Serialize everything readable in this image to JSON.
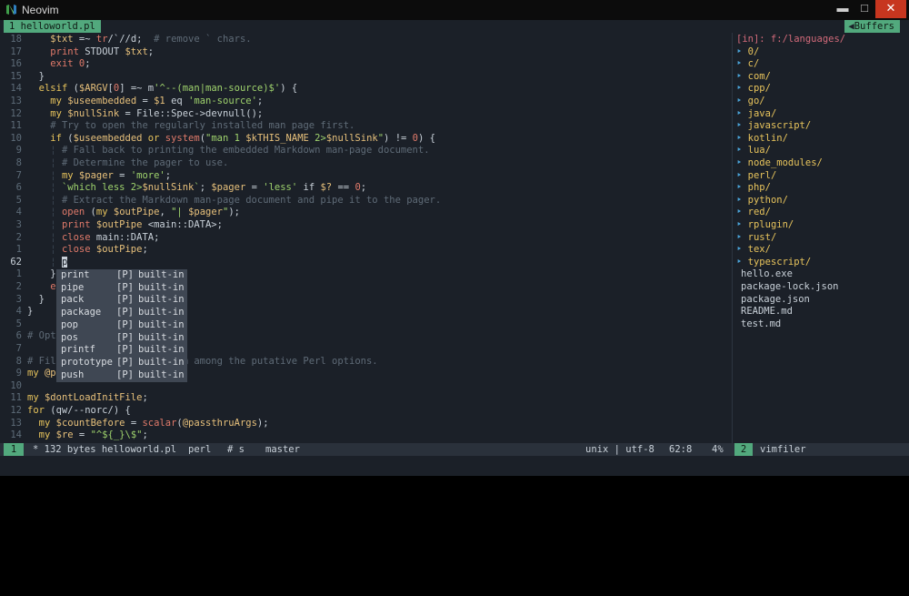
{
  "window": {
    "title": "Neovim",
    "min_glyph": "▬",
    "max_glyph": "□",
    "close_glyph": "✕"
  },
  "tabline": {
    "active_tab": "1 helloworld.pl",
    "buffers_label": "Buffers"
  },
  "editor": {
    "lines": [
      {
        "n": "18",
        "segs": [
          [
            "ig",
            "    "
          ],
          [
            "var",
            "$txt"
          ],
          [
            "op",
            " =~ "
          ],
          [
            "fn",
            "tr"
          ],
          [
            "op",
            "/`//d;"
          ],
          [
            "com",
            "  # remove ` chars."
          ]
        ]
      },
      {
        "n": "17",
        "segs": [
          [
            "ig",
            "    "
          ],
          [
            "fn",
            "print"
          ],
          [
            "plain",
            " STDOUT "
          ],
          [
            "var",
            "$txt"
          ],
          [
            "op",
            ";"
          ]
        ]
      },
      {
        "n": "16",
        "segs": [
          [
            "ig",
            "    "
          ],
          [
            "fn",
            "exit"
          ],
          [
            "op",
            " "
          ],
          [
            "num",
            "0"
          ],
          [
            "op",
            ";"
          ]
        ]
      },
      {
        "n": "15",
        "segs": [
          [
            "ig",
            "  "
          ],
          [
            "op",
            "}"
          ]
        ]
      },
      {
        "n": "14",
        "segs": [
          [
            "ig",
            "  "
          ],
          [
            "kw",
            "elsif"
          ],
          [
            "op",
            " ("
          ],
          [
            "var",
            "$ARGV"
          ],
          [
            "op",
            "["
          ],
          [
            "num",
            "0"
          ],
          [
            "op",
            "] =~ m"
          ],
          [
            "str",
            "'^--(man|man-source)$'"
          ],
          [
            "op",
            ") {"
          ]
        ]
      },
      {
        "n": "13",
        "segs": [
          [
            "ig",
            "    "
          ],
          [
            "kw",
            "my"
          ],
          [
            "op",
            " "
          ],
          [
            "var",
            "$useembedded"
          ],
          [
            "op",
            " = "
          ],
          [
            "var",
            "$1"
          ],
          [
            "op",
            " eq "
          ],
          [
            "str",
            "'man-source'"
          ],
          [
            "op",
            ";"
          ]
        ]
      },
      {
        "n": "12",
        "segs": [
          [
            "ig",
            "    "
          ],
          [
            "kw",
            "my"
          ],
          [
            "op",
            " "
          ],
          [
            "var",
            "$nullSink"
          ],
          [
            "op",
            " = File::Spec->devnull();"
          ]
        ]
      },
      {
        "n": "11",
        "segs": [
          [
            "ig",
            "    "
          ],
          [
            "com",
            "# Try to open the regularly installed man page first."
          ]
        ]
      },
      {
        "n": "10",
        "segs": [
          [
            "ig",
            "    "
          ],
          [
            "kw",
            "if"
          ],
          [
            "op",
            " ("
          ],
          [
            "var",
            "$useembedded"
          ],
          [
            "kw",
            " or "
          ],
          [
            "fn",
            "system"
          ],
          [
            "op",
            "("
          ],
          [
            "str",
            "\"man 1 "
          ],
          [
            "var",
            "$kTHIS_NAME"
          ],
          [
            "str",
            " 2>"
          ],
          [
            "var",
            "$nullSink"
          ],
          [
            "str",
            "\""
          ],
          [
            "op",
            ") != "
          ],
          [
            "num",
            "0"
          ],
          [
            "op",
            ") {"
          ]
        ]
      },
      {
        "n": "9",
        "segs": [
          [
            "ig",
            "    ¦ "
          ],
          [
            "com",
            "# Fall back to printing the embedded Markdown man-page document."
          ]
        ]
      },
      {
        "n": "8",
        "segs": [
          [
            "ig",
            "    ¦ "
          ],
          [
            "com",
            "# Determine the pager to use."
          ]
        ]
      },
      {
        "n": "7",
        "segs": [
          [
            "ig",
            "    ¦ "
          ],
          [
            "kw",
            "my"
          ],
          [
            "op",
            " "
          ],
          [
            "var",
            "$pager"
          ],
          [
            "op",
            " = "
          ],
          [
            "str",
            "'more'"
          ],
          [
            "op",
            ";"
          ]
        ]
      },
      {
        "n": "6",
        "segs": [
          [
            "ig",
            "    ¦ "
          ],
          [
            "str",
            "`which less 2>"
          ],
          [
            "var",
            "$nullSink"
          ],
          [
            "str",
            "`"
          ],
          [
            "op",
            "; "
          ],
          [
            "var",
            "$pager"
          ],
          [
            "op",
            " = "
          ],
          [
            "str",
            "'less'"
          ],
          [
            "op",
            " if "
          ],
          [
            "var",
            "$?"
          ],
          [
            "op",
            " == "
          ],
          [
            "num",
            "0"
          ],
          [
            "op",
            ";"
          ]
        ]
      },
      {
        "n": "5",
        "segs": [
          [
            "ig",
            "    ¦ "
          ],
          [
            "com",
            "# Extract the Markdown man-page document and pipe it to the pager."
          ]
        ]
      },
      {
        "n": "4",
        "segs": [
          [
            "ig",
            "    ¦ "
          ],
          [
            "fn",
            "open"
          ],
          [
            "op",
            " ("
          ],
          [
            "kw",
            "my"
          ],
          [
            "op",
            " "
          ],
          [
            "var",
            "$outPipe"
          ],
          [
            "op",
            ", "
          ],
          [
            "str",
            "\"| "
          ],
          [
            "var",
            "$pager"
          ],
          [
            "str",
            "\""
          ],
          [
            "op",
            ");"
          ]
        ]
      },
      {
        "n": "3",
        "segs": [
          [
            "ig",
            "    ¦ "
          ],
          [
            "fn",
            "print"
          ],
          [
            "op",
            " "
          ],
          [
            "var",
            "$outPipe"
          ],
          [
            "op",
            " <main::DATA>;"
          ]
        ]
      },
      {
        "n": "2",
        "segs": [
          [
            "ig",
            "    ¦ "
          ],
          [
            "fn",
            "close"
          ],
          [
            "op",
            " main::DATA;"
          ]
        ]
      },
      {
        "n": "1",
        "segs": [
          [
            "ig",
            "    ¦ "
          ],
          [
            "fn",
            "close"
          ],
          [
            "op",
            " "
          ],
          [
            "var",
            "$outPipe"
          ],
          [
            "op",
            ";"
          ]
        ]
      },
      {
        "n": "62",
        "cur": true,
        "segs": [
          [
            "ig",
            "    ¦ "
          ],
          [
            "cursor",
            "p"
          ]
        ]
      },
      {
        "n": "1",
        "segs": [
          [
            "ig",
            "    "
          ],
          [
            "op",
            "}"
          ]
        ]
      },
      {
        "n": "2",
        "segs": [
          [
            "ig",
            "    "
          ],
          [
            "fn",
            "e"
          ]
        ]
      },
      {
        "n": "3",
        "segs": [
          [
            "ig",
            "  "
          ],
          [
            "op",
            "}"
          ]
        ]
      },
      {
        "n": "4",
        "segs": [
          [
            "op",
            "}"
          ]
        ]
      },
      {
        "n": "5",
        "segs": [
          [
            "plain",
            ""
          ]
        ]
      },
      {
        "n": "6",
        "segs": [
          [
            "com",
            "# Opt"
          ]
        ]
      },
      {
        "n": "7",
        "segs": [
          [
            "plain",
            ""
          ]
        ]
      },
      {
        "n": "8",
        "segs": [
          [
            "com",
            "# Fil                   from among the putative Perl options."
          ]
        ]
      },
      {
        "n": "9",
        "segs": [
          [
            "kw",
            "my"
          ],
          [
            "op",
            " "
          ],
          [
            "var",
            "@p"
          ]
        ]
      },
      {
        "n": "10",
        "segs": [
          [
            "plain",
            ""
          ]
        ]
      },
      {
        "n": "11",
        "segs": [
          [
            "kw",
            "my"
          ],
          [
            "op",
            " "
          ],
          [
            "var",
            "$dontLoadInitFile"
          ],
          [
            "op",
            ";"
          ]
        ]
      },
      {
        "n": "12",
        "segs": [
          [
            "kw",
            "for"
          ],
          [
            "op",
            " (qw/--norc/) {"
          ]
        ]
      },
      {
        "n": "13",
        "segs": [
          [
            "ig",
            "  "
          ],
          [
            "kw",
            "my"
          ],
          [
            "op",
            " "
          ],
          [
            "var",
            "$countBefore"
          ],
          [
            "op",
            " = "
          ],
          [
            "fn",
            "scalar"
          ],
          [
            "op",
            "("
          ],
          [
            "var",
            "@passthruArgs"
          ],
          [
            "op",
            ");"
          ]
        ]
      },
      {
        "n": "14",
        "segs": [
          [
            "ig",
            "  "
          ],
          [
            "kw",
            "my"
          ],
          [
            "op",
            " "
          ],
          [
            "var",
            "$re"
          ],
          [
            "op",
            " = "
          ],
          [
            "str",
            "\"^${_}\\$\""
          ],
          [
            "op",
            ";"
          ]
        ]
      }
    ]
  },
  "completion": {
    "items": [
      {
        "word": "print",
        "kind": "[P]",
        "menu": "built-in"
      },
      {
        "word": "pipe",
        "kind": "[P]",
        "menu": "built-in"
      },
      {
        "word": "pack",
        "kind": "[P]",
        "menu": "built-in"
      },
      {
        "word": "package",
        "kind": "[P]",
        "menu": "built-in"
      },
      {
        "word": "pop",
        "kind": "[P]",
        "menu": "built-in"
      },
      {
        "word": "pos",
        "kind": "[P]",
        "menu": "built-in"
      },
      {
        "word": "printf",
        "kind": "[P]",
        "menu": "built-in"
      },
      {
        "word": "prototype",
        "kind": "[P]",
        "menu": "built-in"
      },
      {
        "word": "push",
        "kind": "[P]",
        "menu": "built-in"
      }
    ]
  },
  "filer": {
    "header": "[in]: f:/languages/",
    "dirs": [
      "0/",
      "c/",
      "com/",
      "cpp/",
      "go/",
      "java/",
      "javascript/",
      "kotlin/",
      "lua/",
      "node_modules/",
      "perl/",
      "php/",
      "python/",
      "red/",
      "rplugin/",
      "rust/",
      "tex/",
      "typescript/"
    ],
    "files": [
      "hello.exe",
      "package-lock.json",
      "package.json",
      "README.md",
      "test.md"
    ]
  },
  "statusline": {
    "mode_num": "1",
    "file_info": "* 132 bytes helloworld.pl",
    "filetype": "perl",
    "extra": "# s",
    "branch": "master",
    "fileformat": "unix | utf-8",
    "position": "62:8",
    "percent": "4%",
    "side_num": "2",
    "side_name": "vimfiler"
  },
  "colors": {
    "accent": "#52a97d",
    "background": "#1b2028",
    "close": "#c7361f"
  }
}
